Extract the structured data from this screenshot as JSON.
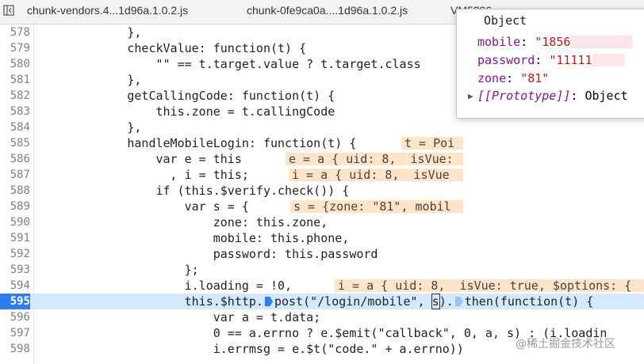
{
  "tabs": [
    {
      "label": "chunk-vendors.4...1d96a.1.0.2.js"
    },
    {
      "label": "chunk-0fe9ca0a....1d96a.1.0.2.js"
    },
    {
      "label": "VM5296"
    }
  ],
  "code": {
    "current_line": "595",
    "lines": [
      {
        "num": "578",
        "text": "            },"
      },
      {
        "num": "579",
        "text": "            checkValue: function(t) {"
      },
      {
        "num": "580",
        "text": "                \"\" == t.target.value ? t.target.class"
      },
      {
        "num": "581",
        "text": "            },"
      },
      {
        "num": "582",
        "text": "            getCallingCode: function(t) {"
      },
      {
        "num": "583",
        "text": "                this.zone = t.callingCode"
      },
      {
        "num": "584",
        "text": "            },"
      },
      {
        "num": "585",
        "text": "            handleMobileLogin: function(t) {",
        "ann": "t = Poi"
      },
      {
        "num": "586",
        "text": "                var e = this",
        "ann": "e = a {_uid: 8, _isVue:"
      },
      {
        "num": "587",
        "text": "                  , i = this;",
        "ann": "i = a {_uid: 8, _isVue"
      },
      {
        "num": "588",
        "text": "                if (this.$verify.check()) {"
      },
      {
        "num": "589",
        "text": "                    var s = {",
        "ann": "s = {zone: \"81\", mobil"
      },
      {
        "num": "590",
        "text": "                        zone: this.zone,"
      },
      {
        "num": "591",
        "text": "                        mobile: this.phone,"
      },
      {
        "num": "592",
        "text": "                        password: this.password"
      },
      {
        "num": "593",
        "text": "                    };"
      },
      {
        "num": "594",
        "text": "                    i.loading = !0,",
        "ann": "i = a {_uid: 8, _isVue: true, $options: {"
      },
      {
        "num": "595",
        "pre": "                    this.$http.",
        "call": "post",
        "args1": "(\"/login/mobile\", ",
        "arg": "s",
        "args2": ").",
        "call2": "then",
        "args3": "(function(t) {"
      },
      {
        "num": "596",
        "text": "                        var a = t.data;"
      },
      {
        "num": "597",
        "text": "                        0 == a.errno ? e.$emit(\"callback\", 0, a, s) : (i.loadin"
      },
      {
        "num": "598",
        "text": "                        i.errmsg = e.$t(\"code.\" + a.errno))"
      }
    ]
  },
  "popup": {
    "title": "Object",
    "props": [
      {
        "key": "mobile",
        "value": "\"1856"
      },
      {
        "key": "password",
        "value": "\"11111"
      },
      {
        "key": "zone",
        "value": "\"81\""
      }
    ],
    "proto_key": "[[Prototype]]",
    "proto_value": "Object"
  },
  "watermark": "@稀土掘金技术社区"
}
